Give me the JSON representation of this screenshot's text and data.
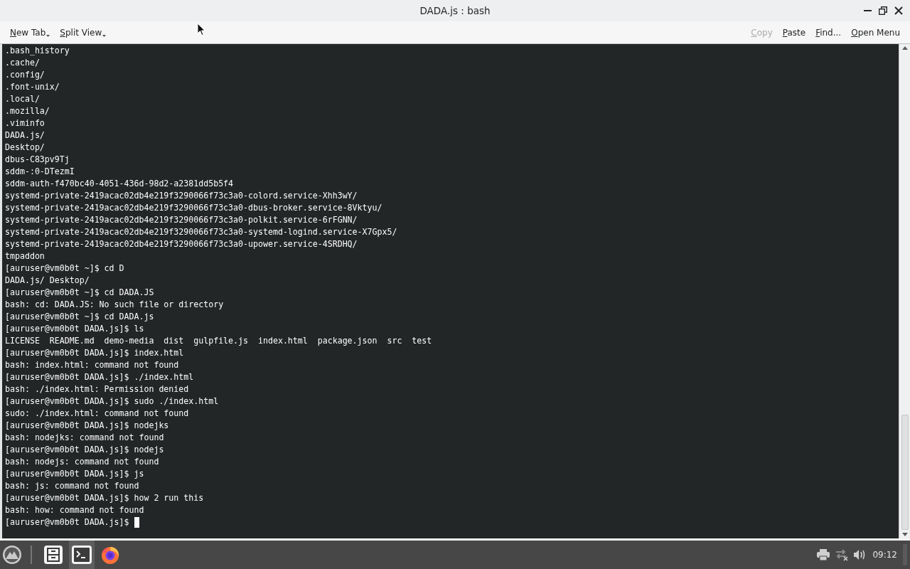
{
  "window": {
    "title": "DADA.js : bash"
  },
  "toolbar": {
    "left": [
      {
        "label": "New Tab",
        "menu": true
      },
      {
        "label": "Split View",
        "menu": true
      }
    ],
    "right": [
      {
        "label": "Copy",
        "disabled": true
      },
      {
        "label": "Paste",
        "disabled": false
      },
      {
        "label": "Find...",
        "disabled": false
      },
      {
        "label": "Open Menu",
        "disabled": false
      }
    ]
  },
  "terminal": {
    "lines": [
      ".bash_history",
      ".cache/",
      ".config/",
      ".font-unix/",
      ".local/",
      ".mozilla/",
      ".viminfo",
      "DADA.js/",
      "Desktop/",
      "dbus-C83pv9Tj",
      "sddm-:0-DTezmI",
      "sddm-auth-f470bc40-4051-436d-98d2-a2381dd5b5f4",
      "systemd-private-2419acac02db4e219f3290066f73c3a0-colord.service-Xhh3wY/",
      "systemd-private-2419acac02db4e219f3290066f73c3a0-dbus-broker.service-8Vktyu/",
      "systemd-private-2419acac02db4e219f3290066f73c3a0-polkit.service-6rFGNN/",
      "systemd-private-2419acac02db4e219f3290066f73c3a0-systemd-logind.service-X7Gpx5/",
      "systemd-private-2419acac02db4e219f3290066f73c3a0-upower.service-4SRDHQ/",
      "tmpaddon",
      "[auruser@vm0b0t ~]$ cd D",
      "DADA.js/ Desktop/",
      "[auruser@vm0b0t ~]$ cd DADA.JS",
      "bash: cd: DADA.JS: No such file or directory",
      "[auruser@vm0b0t ~]$ cd DADA.js",
      "[auruser@vm0b0t DADA.js]$ ls",
      "LICENSE  README.md  demo-media  dist  gulpfile.js  index.html  package.json  src  test",
      "[auruser@vm0b0t DADA.js]$ index.html",
      "bash: index.html: command not found",
      "[auruser@vm0b0t DADA.js]$ ./index.html",
      "bash: ./index.html: Permission denied",
      "[auruser@vm0b0t DADA.js]$ sudo ./index.html",
      "sudo: ./index.html: command not found",
      "[auruser@vm0b0t DADA.js]$ nodejks",
      "bash: nodejks: command not found",
      "[auruser@vm0b0t DADA.js]$ nodejs",
      "bash: nodejs: command not found",
      "[auruser@vm0b0t DADA.js]$ js",
      "bash: js: command not found",
      "[auruser@vm0b0t DADA.js]$ how 2 run this",
      "bash: how: command not found",
      "[auruser@vm0b0t DADA.js]$"
    ],
    "cursor": true
  },
  "taskbar": {
    "apps": [
      {
        "kind": "files",
        "selected": false
      },
      {
        "kind": "terminal",
        "selected": true
      },
      {
        "kind": "browser",
        "selected": false
      }
    ],
    "clock": "09:12"
  }
}
